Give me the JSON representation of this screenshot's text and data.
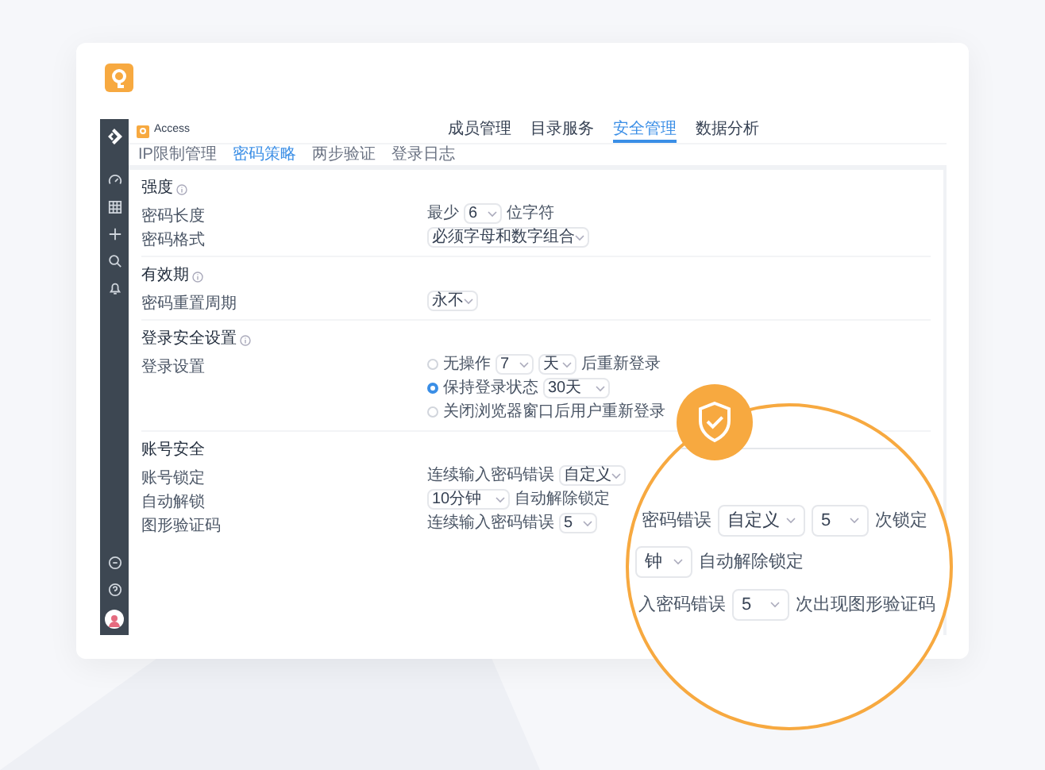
{
  "app": {
    "name": "Access"
  },
  "nav_tabs": [
    {
      "label": "成员管理",
      "selected": false
    },
    {
      "label": "目录服务",
      "selected": false
    },
    {
      "label": "安全管理",
      "selected": true
    },
    {
      "label": "数据分析",
      "selected": false
    }
  ],
  "sub_tabs": [
    {
      "label": "IP限制管理",
      "selected": false
    },
    {
      "label": "密码策略",
      "selected": true
    },
    {
      "label": "两步验证",
      "selected": false
    },
    {
      "label": "登录日志",
      "selected": false
    }
  ],
  "sections": [
    {
      "title": "强度",
      "info": true,
      "rows": [
        {
          "label": "密码长度",
          "lines": [
            [
              {
                "kind": "text",
                "text": "最少"
              },
              {
                "kind": "select",
                "value": "6"
              },
              {
                "kind": "text",
                "text": "位字符"
              }
            ]
          ]
        },
        {
          "label": "密码格式",
          "lines": [
            [
              {
                "kind": "select",
                "value": "必须字母和数字组合"
              }
            ]
          ]
        }
      ]
    },
    {
      "title": "有效期",
      "info": true,
      "rows": [
        {
          "label": "密码重置周期",
          "lines": [
            [
              {
                "kind": "select",
                "value": "永不"
              }
            ]
          ]
        }
      ]
    },
    {
      "title": "登录安全设置",
      "info": true,
      "rows": [
        {
          "label": "登录设置",
          "lines": [
            [
              {
                "kind": "radio",
                "selected": false,
                "text": "无操作"
              },
              {
                "kind": "select",
                "value": "7"
              },
              {
                "kind": "select",
                "value": "天"
              },
              {
                "kind": "text",
                "text": "后重新登录"
              }
            ],
            [
              {
                "kind": "radio",
                "selected": true,
                "text": "保持登录状态"
              },
              {
                "kind": "select",
                "value": "30天"
              }
            ],
            [
              {
                "kind": "radio",
                "selected": false,
                "text": "关闭浏览器窗口后用户重新登录"
              }
            ]
          ]
        }
      ]
    },
    {
      "title": "账号安全",
      "info": false,
      "rows": [
        {
          "label": "账号锁定",
          "lines": [
            [
              {
                "kind": "text",
                "text": "连续输入密码错误"
              },
              {
                "kind": "select",
                "value": "自定义"
              }
            ]
          ]
        },
        {
          "label": "自动解锁",
          "lines": [
            [
              {
                "kind": "select",
                "value": "10分钟"
              },
              {
                "kind": "text",
                "text": "自动解除锁定"
              }
            ]
          ]
        },
        {
          "label": "图形验证码",
          "lines": [
            [
              {
                "kind": "text",
                "text": "连续输入密码错误"
              },
              {
                "kind": "select",
                "value": "5"
              }
            ]
          ]
        }
      ]
    }
  ],
  "magnifier": {
    "rows": [
      [
        {
          "kind": "text",
          "text": "密码错误"
        },
        {
          "kind": "select",
          "value": "自定义"
        },
        {
          "kind": "select",
          "value": "5"
        },
        {
          "kind": "text",
          "text": "次锁定"
        }
      ],
      [
        {
          "kind": "select",
          "value": "钟"
        },
        {
          "kind": "text",
          "text": "自动解除锁定"
        }
      ],
      [
        {
          "kind": "text",
          "text": "入密码错误"
        },
        {
          "kind": "select",
          "value": "5"
        },
        {
          "kind": "text",
          "text": "次出现图形验证码"
        }
      ]
    ]
  }
}
